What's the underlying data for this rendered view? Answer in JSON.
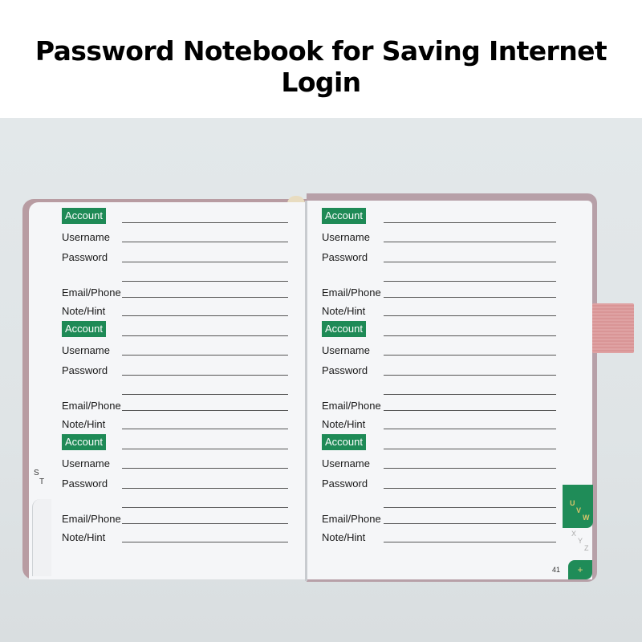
{
  "title": "Password Notebook for Saving Internet Login",
  "labels": {
    "account": "Account",
    "username": "Username",
    "password": "Password",
    "email": "Email/Phone",
    "note": "Note/Hint"
  },
  "left_page": {
    "alpha_tab": [
      "S",
      "T"
    ],
    "entries": 3
  },
  "right_page": {
    "entries": 3,
    "page_number": "41",
    "alpha_tabs": {
      "active": [
        "U",
        "V",
        "W"
      ],
      "next": [
        "X",
        "Y",
        "Z"
      ],
      "extra": "+"
    }
  },
  "colors": {
    "accent_green": "#1e8a56",
    "cover_pink": "#b89ca2",
    "elastic_pink": "#dfa2a3",
    "tab_gold": "#d9c46a"
  }
}
